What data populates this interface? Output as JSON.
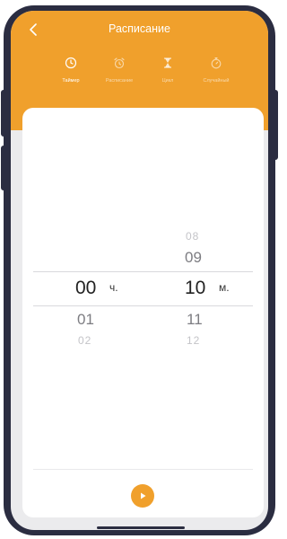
{
  "header": {
    "title": "Расписание",
    "tabs": [
      {
        "label": "Таймер",
        "icon": "clock-icon",
        "active": true
      },
      {
        "label": "Расписание",
        "icon": "alarm-clock-icon",
        "active": false
      },
      {
        "label": "Цикл",
        "icon": "hourglass-icon",
        "active": false
      },
      {
        "label": "Случайный",
        "icon": "stopwatch-icon",
        "active": false
      }
    ]
  },
  "picker": {
    "hours": {
      "selected": "00",
      "below1": "01",
      "below2": "02",
      "unit": "ч."
    },
    "minutes": {
      "above2": "08",
      "above1": "09",
      "selected": "10",
      "below1": "11",
      "below2": "12",
      "unit": "м."
    }
  },
  "footer": {
    "action_icon": "play-icon"
  },
  "colors": {
    "accent": "#f0a02c",
    "frame": "#2b2d41"
  }
}
